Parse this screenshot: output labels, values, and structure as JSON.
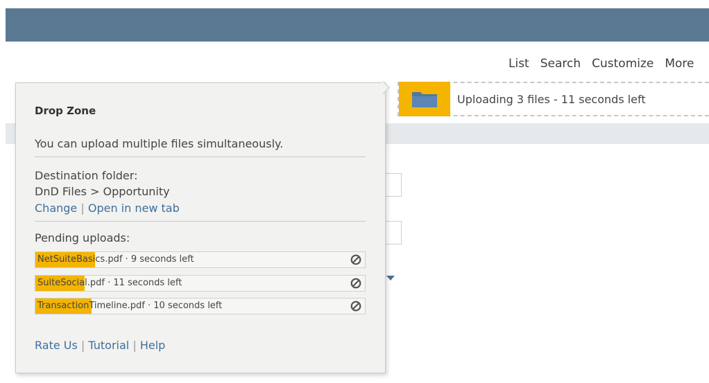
{
  "nav": {
    "items": [
      "List",
      "Search",
      "Customize",
      "More"
    ]
  },
  "dropzone": {
    "icon": "folder-icon",
    "status": "Uploading 3 files - 11 seconds left",
    "accent": "#f4b400"
  },
  "popup": {
    "title": "Drop Zone",
    "description": "You can upload multiple files simultaneously.",
    "destination_label": "Destination folder:",
    "destination_path": "DnD Files > Opportunity",
    "change_link": "Change",
    "separator": "|",
    "open_tab_link": "Open in new tab",
    "pending_label": "Pending uploads:",
    "uploads": [
      {
        "text": "NetSuiteBasics.pdf · 9 seconds left",
        "progress": 0.18
      },
      {
        "text": "SuiteSocial.pdf · 11 seconds left",
        "progress": 0.15
      },
      {
        "text": "TransactionTimeline.pdf · 10 seconds left",
        "progress": 0.17
      }
    ],
    "footer_links": [
      "Rate Us",
      "Tutorial",
      "Help"
    ],
    "cancel_icon": "cancel-icon"
  },
  "colors": {
    "header": "#5a7891",
    "link": "#3f6f9e",
    "progress": "#f4b400"
  }
}
